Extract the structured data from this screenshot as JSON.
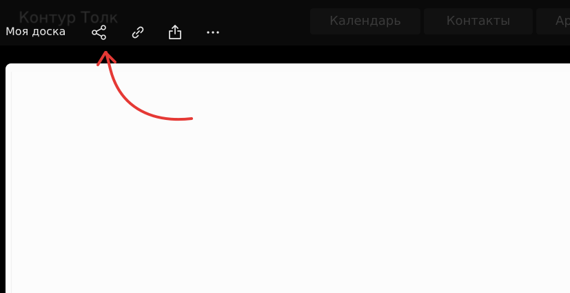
{
  "background_app": {
    "brand": "Контур Толк",
    "tabs": [
      "Календарь",
      "Контакты",
      "Ар"
    ]
  },
  "toolbar": {
    "title": "Моя доска",
    "icons": [
      "share-icon",
      "link-icon",
      "export-icon",
      "more-icon"
    ]
  },
  "colors": {
    "background": "#000000",
    "canvas": "#fbfbfb",
    "annotation": "#e53935",
    "toolbar_text": "#e9e9e9"
  }
}
